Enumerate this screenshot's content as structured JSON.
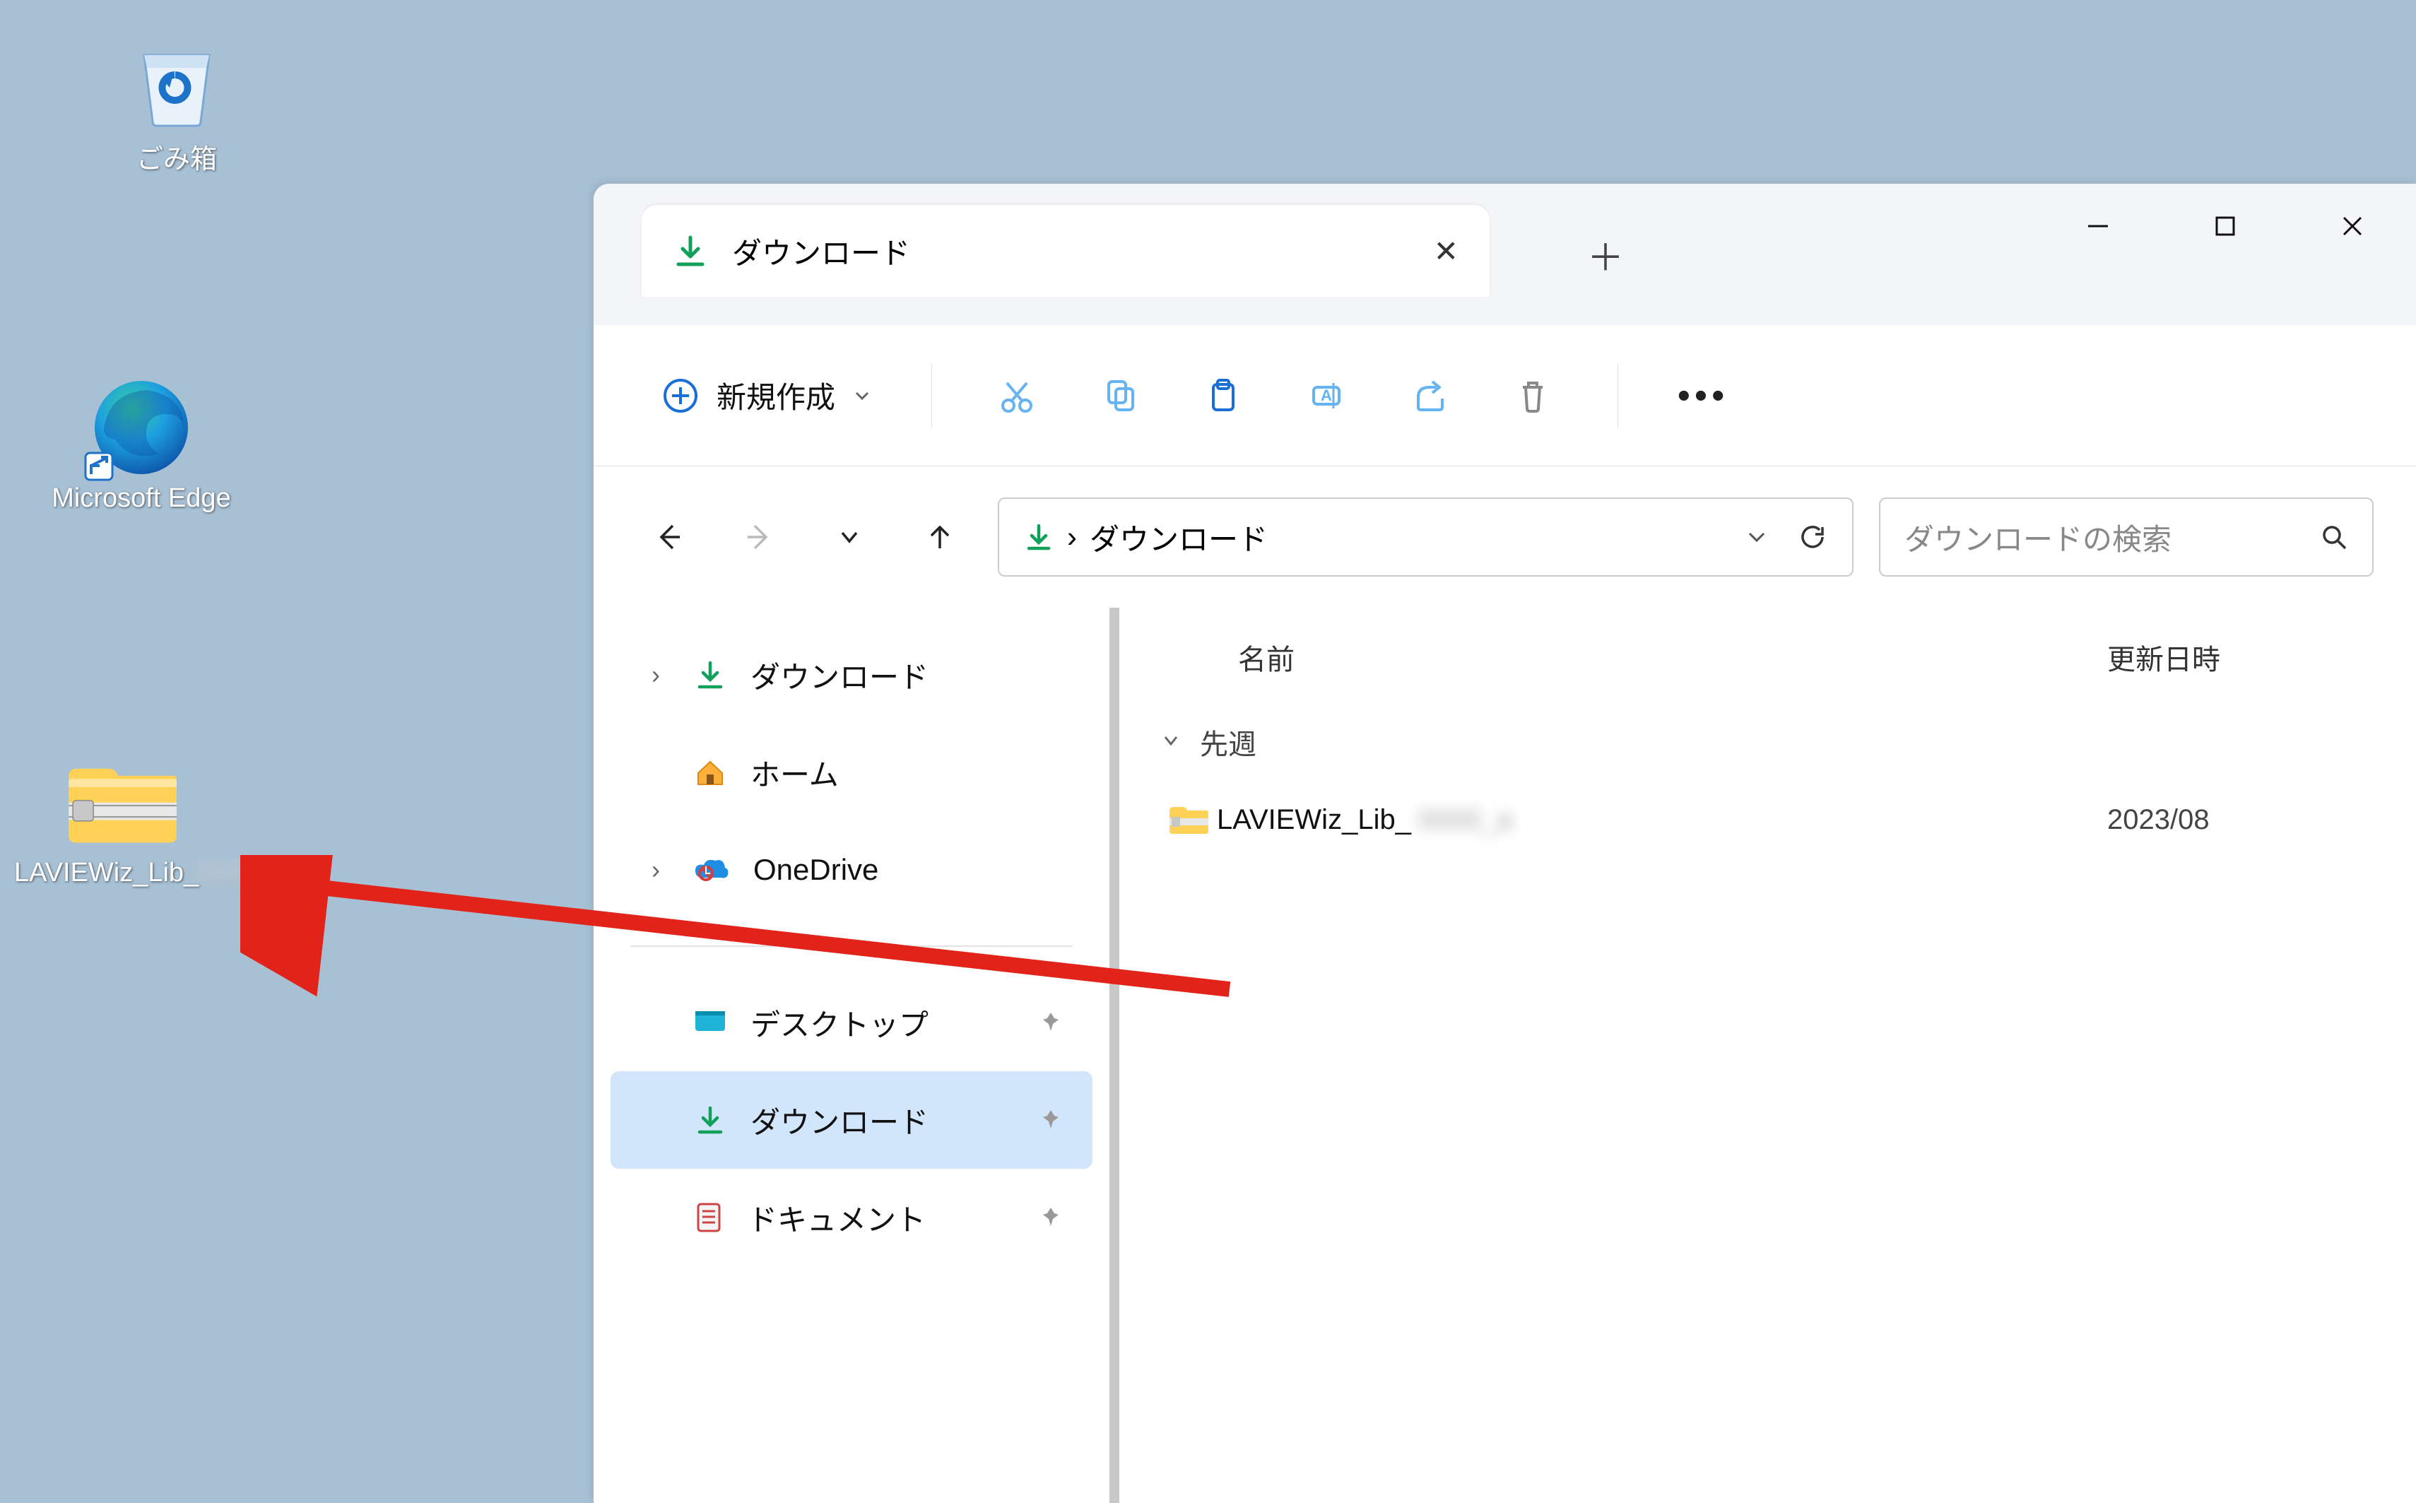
{
  "desktop": {
    "recycle_bin_label": "ごみ箱",
    "edge_label": "Microsoft Edge",
    "zip_label": "LAVIEWiz_Lib_"
  },
  "window": {
    "tab_title": "ダウンロード",
    "toolbar": {
      "new_label": "新規作成"
    },
    "breadcrumb": {
      "location": "ダウンロード"
    },
    "search": {
      "placeholder": "ダウンロードの検索"
    }
  },
  "sidebar": {
    "items": [
      {
        "label": "ダウンロード",
        "icon": "download",
        "chev": true
      },
      {
        "label": "ホーム",
        "icon": "home",
        "chev": false
      },
      {
        "label": "OneDrive",
        "icon": "onedrive",
        "chev": true
      }
    ],
    "quick": [
      {
        "label": "デスクトップ",
        "icon": "desktop"
      },
      {
        "label": "ダウンロード",
        "icon": "download",
        "active": true
      },
      {
        "label": "ドキュメント",
        "icon": "documents"
      }
    ]
  },
  "content": {
    "col_name": "名前",
    "col_date": "更新日時",
    "group_label": "先週",
    "file": {
      "name_prefix": "LAVIEWiz_Lib_",
      "date_prefix": "2023/08"
    }
  }
}
